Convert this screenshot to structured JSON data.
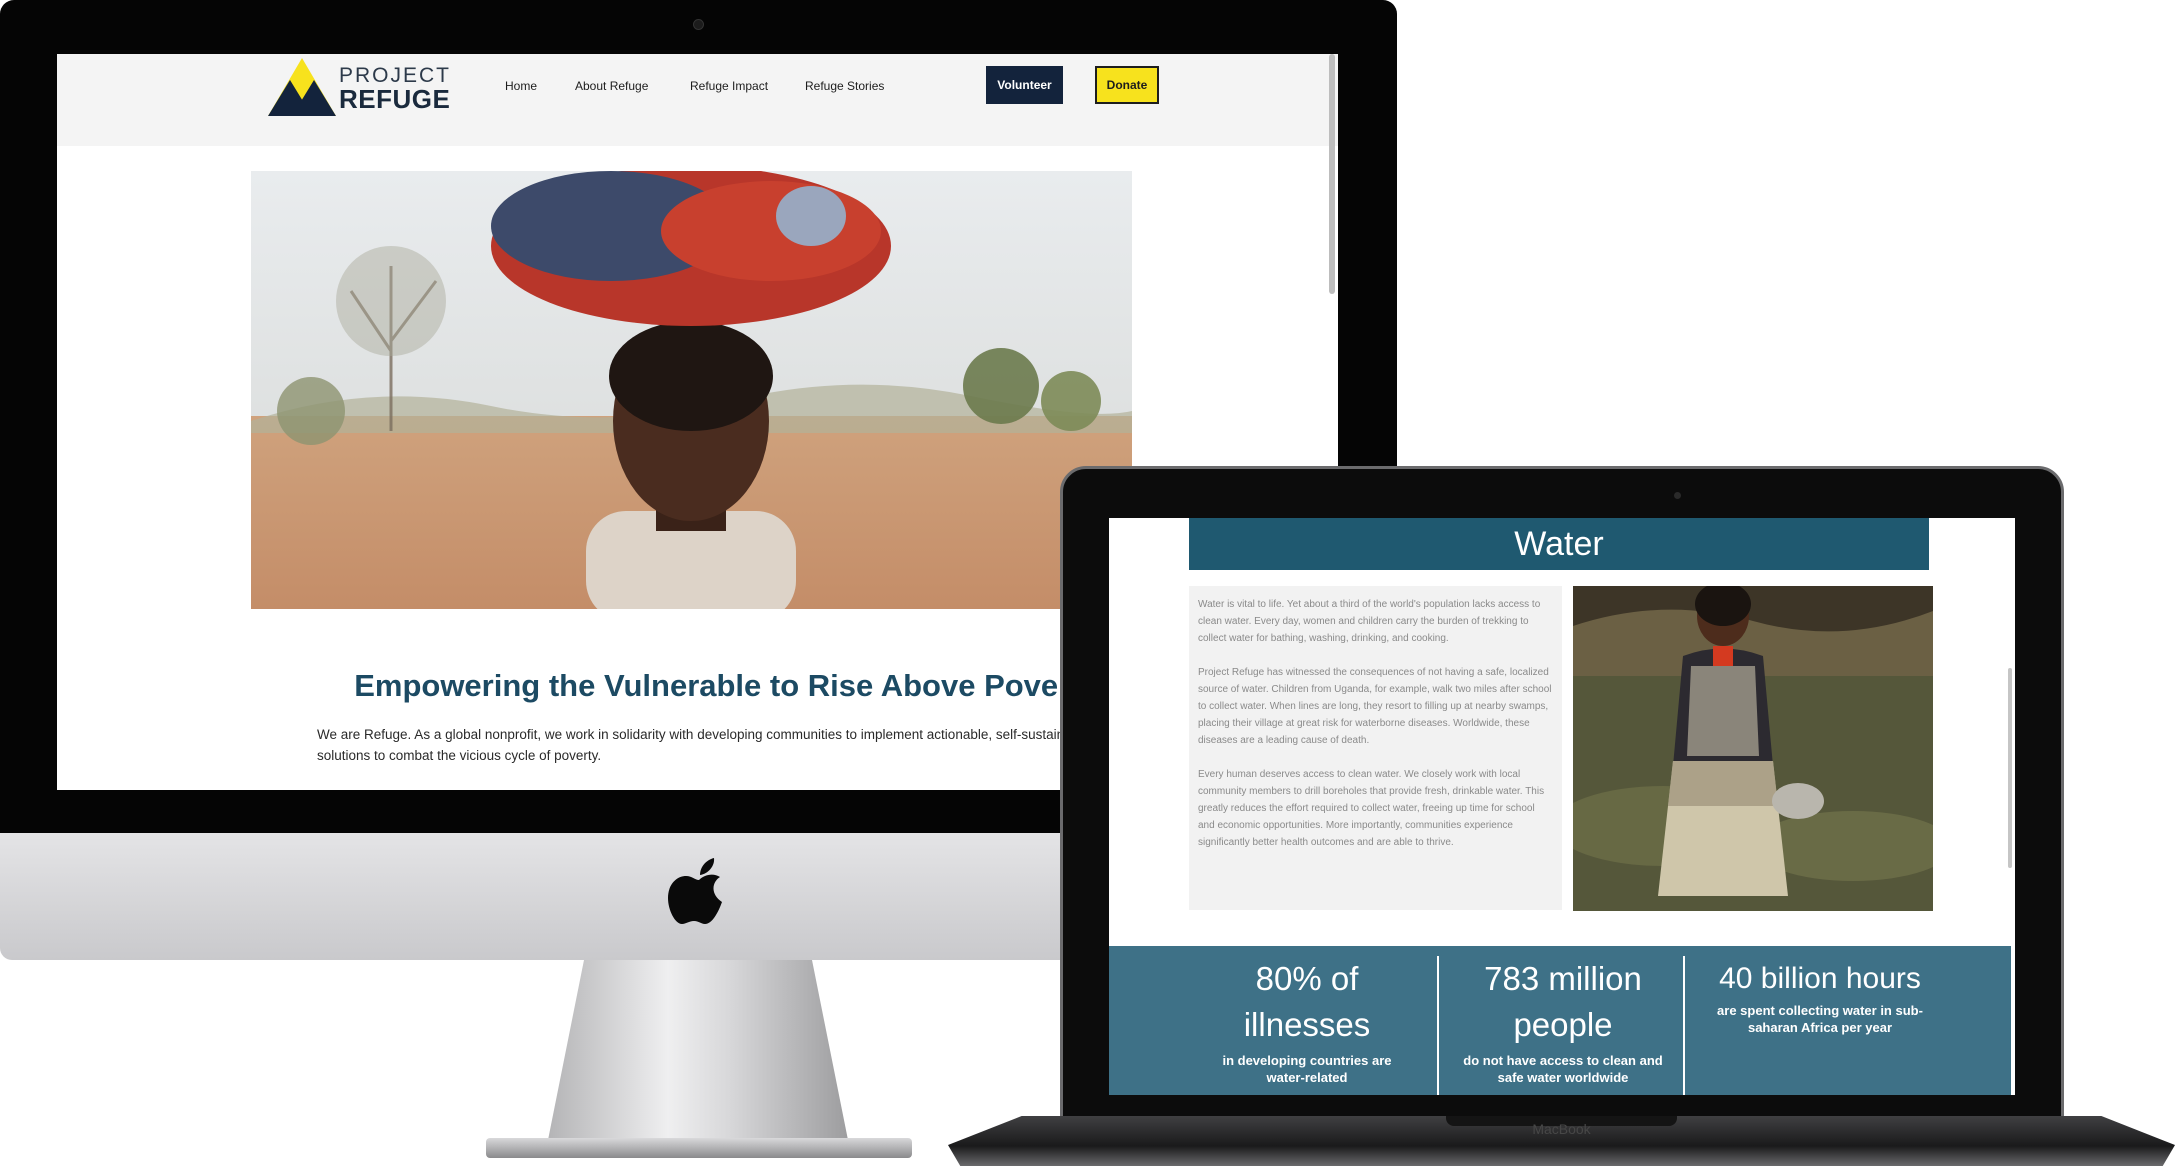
{
  "imac": {
    "site": {
      "logo": {
        "line1": "PROJECT",
        "line2": "REFUGE"
      },
      "nav": {
        "home": "Home",
        "about": "About Refuge",
        "impact": "Refuge Impact",
        "stories": "Refuge Stories",
        "volunteer": "Volunteer",
        "donate": "Donate"
      },
      "headline": "Empowering the Vulnerable to Rise Above Poverty",
      "intro": "We are Refuge. As a global nonprofit, we work in solidarity with developing communities to implement actionable, self-sustaining solutions to combat the vicious cycle of poverty."
    }
  },
  "macbook": {
    "label": "MacBook",
    "site": {
      "section_title": "Water",
      "paragraphs": [
        "Water is vital to life. Yet about a third of the world's population lacks access to clean water. Every day, women and children carry the burden of trekking to collect water for bathing, washing, drinking, and cooking.",
        "Project Refuge has witnessed the consequences of not having a safe, localized source of water. Children from Uganda, for example, walk two miles after school to collect water. When lines are long, they resort to filling up at nearby swamps, placing their village at great risk for waterborne diseases. Worldwide, these diseases are a leading cause of death.",
        "Every human deserves access to clean water. We closely work with local community members to drill boreholes that provide fresh, drinkable water. This greatly reduces the effort required to collect water, freeing up time for school and economic opportunities. More importantly, communities experience significantly better health outcomes and are able to thrive."
      ],
      "stats": [
        {
          "figure": "80% of illnesses",
          "caption": "in developing countries are water-related"
        },
        {
          "figure": "783 million people",
          "caption": "do not have access to clean and safe water worldwide"
        },
        {
          "figure": "40 billion hours",
          "caption": "are spent collecting water in sub-saharan Africa per year"
        }
      ]
    }
  },
  "colors": {
    "brand_navy": "#13233c",
    "brand_yellow": "#f7e21d",
    "headline_teal": "#1c4a63",
    "water_header": "#1f5970",
    "stats_band": "#3e7187"
  }
}
